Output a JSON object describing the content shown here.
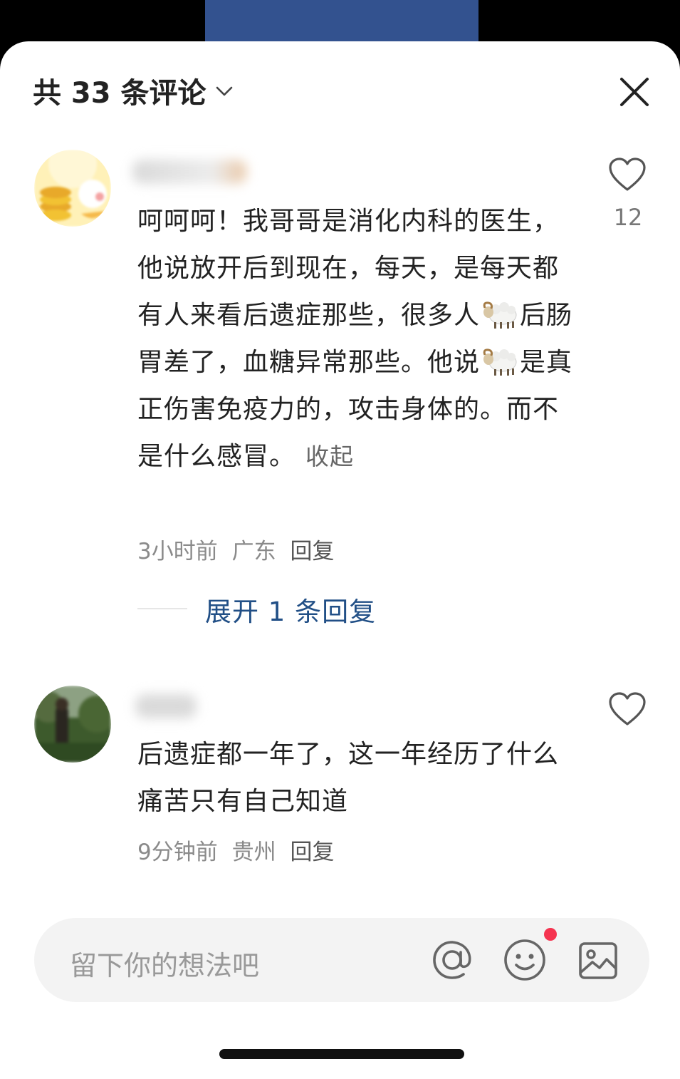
{
  "header": {
    "title": "共 33 条评论"
  },
  "comments": [
    {
      "text_parts": [
        "呵呵呵！我哥哥是消化内科的医生，他说放开后到现在，每天，是每天都有人来看后遗症那些，很多人",
        "后肠胃差了，血糖异常那些。他说",
        "是真正伤害免疫力的，攻击身体的。而不是什么感冒。"
      ],
      "collapse_label": "收起",
      "time": "3小时前",
      "location": "广东",
      "reply_label": "回复",
      "likes": "12",
      "expand_label": "展开 1 条回复"
    },
    {
      "text": "后遗症都一年了，这一年经历了什么痛苦只有自己知道",
      "time": "9分钟前",
      "location": "贵州",
      "reply_label": "回复"
    }
  ],
  "input": {
    "placeholder": "留下你的想法吧"
  },
  "colors": {
    "link": "#214f86",
    "badge": "#f5334f",
    "banner": "#33528f"
  }
}
